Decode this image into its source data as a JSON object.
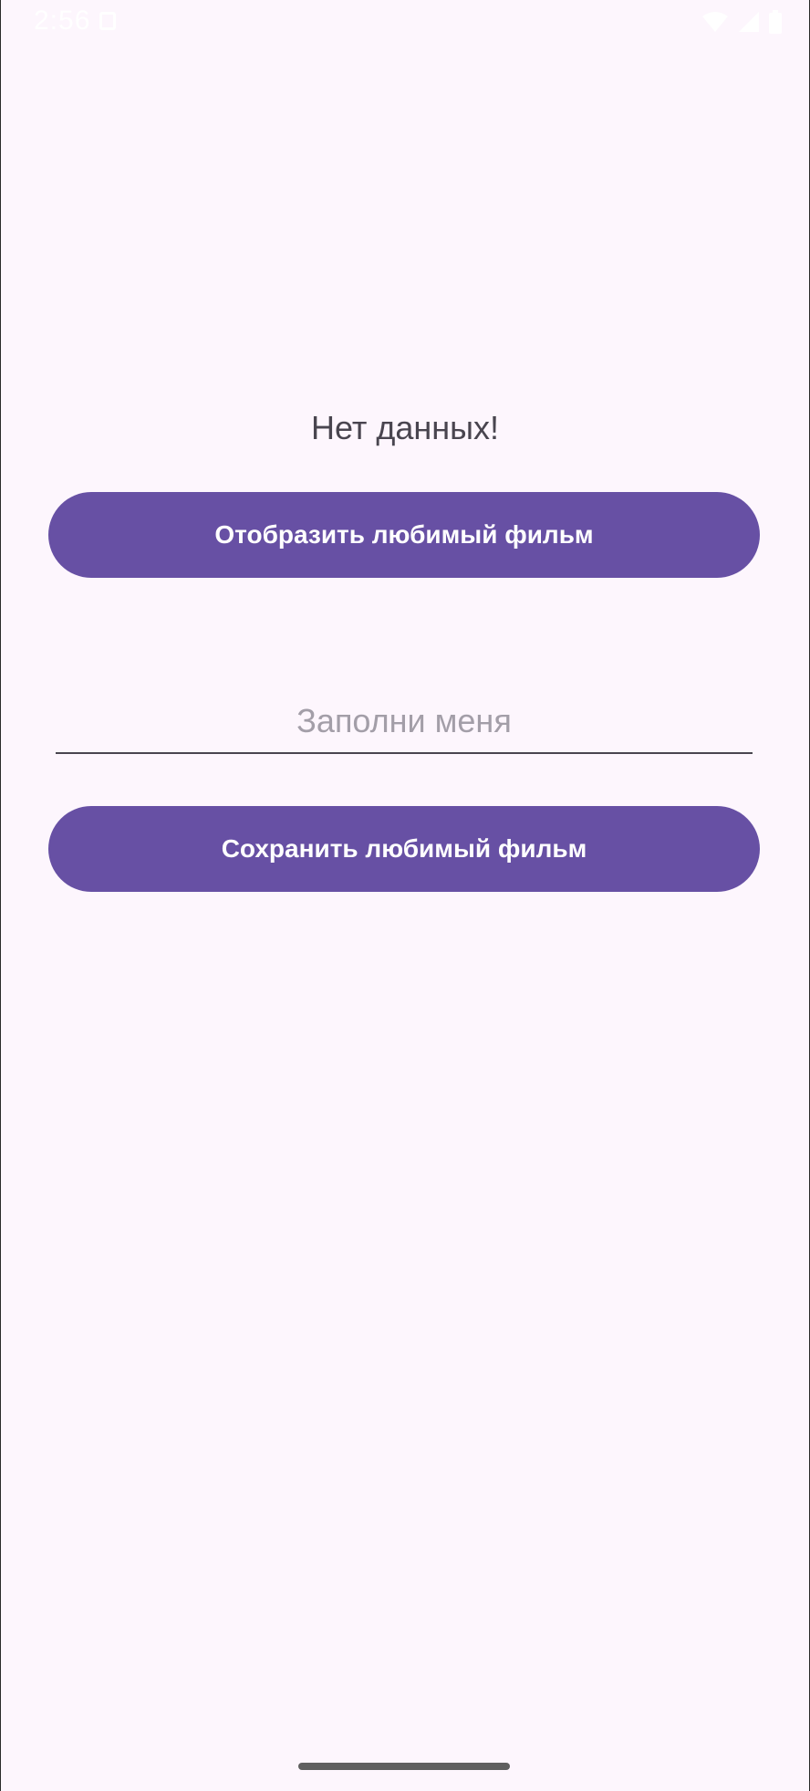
{
  "status_bar": {
    "time": "2:56",
    "icons": [
      "notification-icon",
      "wifi-icon",
      "cellular-signal-icon",
      "battery-icon"
    ]
  },
  "main": {
    "message": "Нет данных!",
    "show_button_label": "Отобразить любимый фильм",
    "input_placeholder": "Заполни меня",
    "input_value": "",
    "save_button_label": "Сохранить любимый фильм"
  },
  "colors": {
    "background": "#fdf6fd",
    "primary": "#6750a4",
    "on_primary": "#ffffff",
    "text": "#49454f",
    "placeholder": "#a39ea8"
  }
}
